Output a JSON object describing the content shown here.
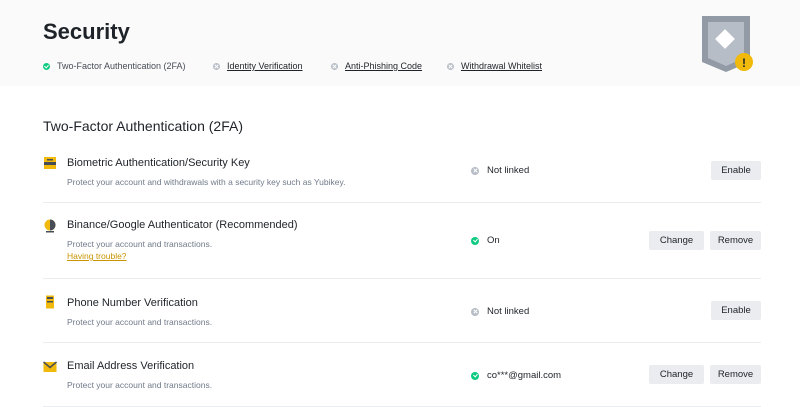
{
  "header": {
    "title": "Security",
    "status_items": [
      {
        "label": "Two-Factor Authentication (2FA)",
        "state": "ok"
      },
      {
        "label": "Identity Verification",
        "state": "missing"
      },
      {
        "label": "Anti-Phishing Code",
        "state": "missing"
      },
      {
        "label": "Withdrawal Whitelist",
        "state": "missing"
      }
    ],
    "shield_badge": "!"
  },
  "section": {
    "title": "Two-Factor Authentication (2FA)"
  },
  "rows": [
    {
      "icon": "security-key-icon",
      "title": "Biometric Authentication/Security Key",
      "description": "Protect your account and withdrawals with a security key such as Yubikey.",
      "status": "Not linked",
      "status_state": "missing",
      "buttons": [
        "Enable"
      ]
    },
    {
      "icon": "authenticator-icon",
      "title": "Binance/Google Authenticator (Recommended)",
      "description": "Protect your account and transactions.",
      "link": "Having trouble?",
      "status": "On",
      "status_state": "ok",
      "buttons": [
        "Change",
        "Remove"
      ]
    },
    {
      "icon": "phone-icon",
      "title": "Phone Number Verification",
      "description": "Protect your account and transactions.",
      "status": "Not linked",
      "status_state": "missing",
      "buttons": [
        "Enable"
      ]
    },
    {
      "icon": "email-icon",
      "title": "Email Address Verification",
      "description": "Protect your account and transactions.",
      "status": "co***@gmail.com",
      "status_state": "ok",
      "buttons": [
        "Change",
        "Remove"
      ]
    }
  ],
  "colors": {
    "accent": "#f0b90b",
    "link": "#c99400",
    "ok": "#0ecb81",
    "inactive": "#b7bdc6",
    "button_bg": "#eaecef"
  }
}
